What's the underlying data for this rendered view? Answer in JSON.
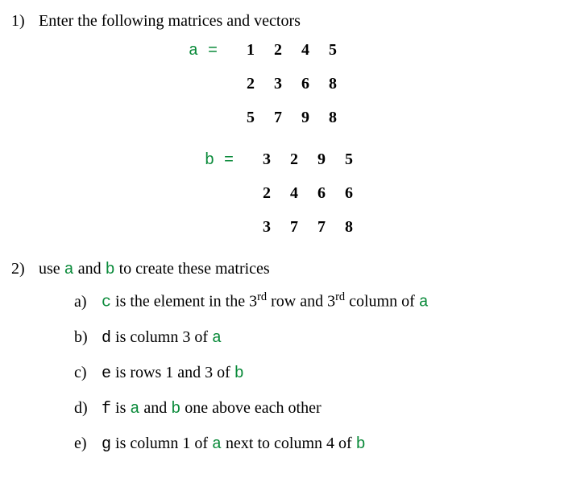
{
  "q1": {
    "num": "1)",
    "text": "Enter the following matrices and vectors",
    "var_a_label": "a =",
    "var_b_label": "b =",
    "matrix_a": [
      [
        "1",
        "2",
        "4",
        "5"
      ],
      [
        "2",
        "3",
        "6",
        "8"
      ],
      [
        "5",
        "7",
        "9",
        "8"
      ]
    ],
    "matrix_b": [
      [
        "3",
        "2",
        "9",
        "5"
      ],
      [
        "2",
        "4",
        "6",
        "6"
      ],
      [
        "3",
        "7",
        "7",
        "8"
      ]
    ]
  },
  "q2": {
    "num": "2)",
    "text_pre": "use ",
    "text_mid": " and ",
    "text_post": " to create these matrices",
    "var_a": "a",
    "var_b": "b",
    "items": {
      "a": {
        "label": "a)",
        "c_var": "c",
        "t1": " is the element in the 3",
        "ord1": "rd",
        "t2": " row and 3",
        "ord2": "rd",
        "t3": " column of ",
        "a_var": "a"
      },
      "b": {
        "label": "b)",
        "d_var": "d",
        "t1": " is column 3 of ",
        "a_var": "a"
      },
      "c": {
        "label": "c)",
        "e_var": "e",
        "t1": " is rows 1 and 3 of ",
        "b_var": "b"
      },
      "d": {
        "label": "d)",
        "f_var": "f",
        "t1": " is ",
        "a_var": "a",
        "t2": " and ",
        "b_var": "b",
        "t3": " one above each other"
      },
      "e": {
        "label": "e)",
        "g_var": "g",
        "t1": " is column 1 of ",
        "a_var": "a",
        "t2": " next to column 4 of ",
        "b_var": "b"
      }
    }
  }
}
